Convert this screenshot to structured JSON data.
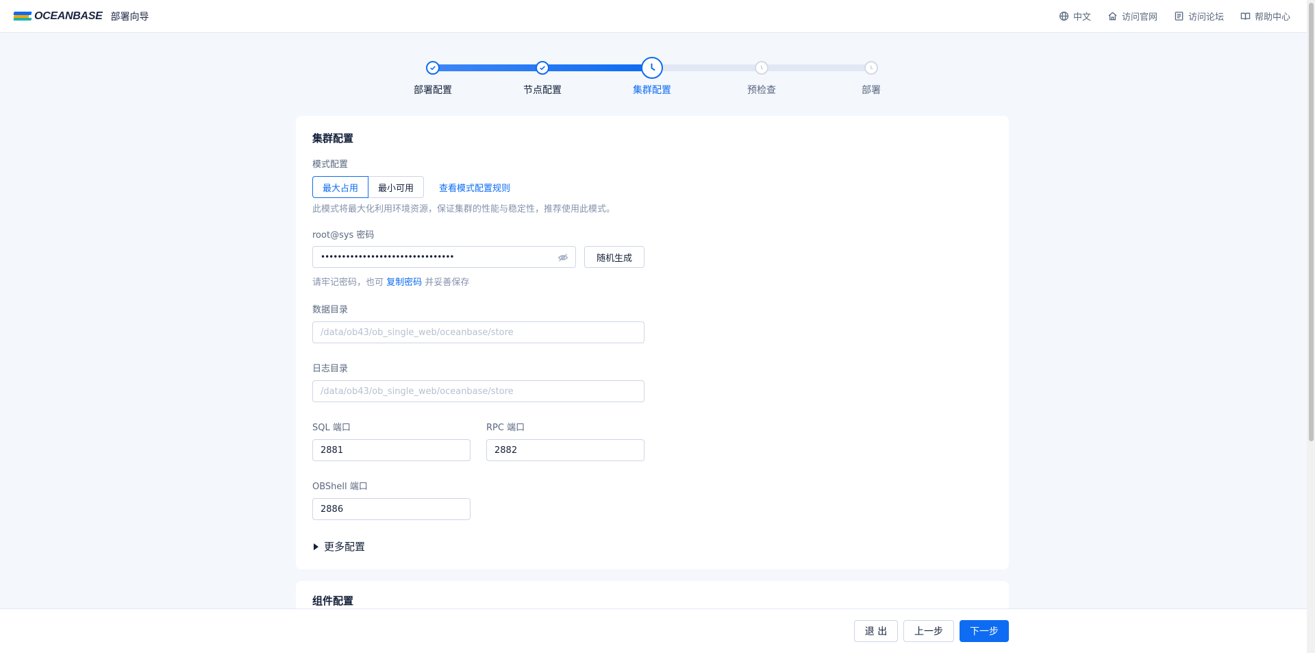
{
  "header": {
    "logo_text": "OCEANBASE",
    "app_name": "部署向导",
    "links": [
      {
        "label": "中文",
        "icon": "globe-icon"
      },
      {
        "label": "访问官网",
        "icon": "home-icon"
      },
      {
        "label": "访问论坛",
        "icon": "forum-icon"
      },
      {
        "label": "帮助中心",
        "icon": "book-icon"
      }
    ]
  },
  "steps": [
    {
      "label": "部署配置",
      "status": "done"
    },
    {
      "label": "节点配置",
      "status": "done"
    },
    {
      "label": "集群配置",
      "status": "active"
    },
    {
      "label": "预检查",
      "status": "todo"
    },
    {
      "label": "部署",
      "status": "todo"
    }
  ],
  "cluster": {
    "title": "集群配置",
    "mode_label": "模式配置",
    "mode_options": [
      "最大占用",
      "最小可用"
    ],
    "mode_selected": "最大占用",
    "mode_rule_link": "查看模式配置规则",
    "mode_hint": "此模式将最大化利用环境资源，保证集群的性能与稳定性，推荐使用此模式。",
    "password_label": "root@sys 密码",
    "password_value": "••••••••••••••••••••••••••••••••",
    "random_button": "随机生成",
    "password_hint_prefix": "请牢记密码，也可",
    "password_hint_link": "复制密码",
    "password_hint_suffix": "并妥善保存",
    "data_dir_label": "数据目录",
    "data_dir_placeholder": "/data/ob43/ob_single_web/oceanbase/store",
    "log_dir_label": "日志目录",
    "log_dir_placeholder": "/data/ob43/ob_single_web/oceanbase/store",
    "sql_port_label": "SQL 端口",
    "sql_port_value": "2881",
    "rpc_port_label": "RPC 端口",
    "rpc_port_value": "2882",
    "obshell_port_label": "OBShell 端口",
    "obshell_port_value": "2886",
    "more_config": "更多配置"
  },
  "component": {
    "title": "组件配置"
  },
  "footer": {
    "exit": "退 出",
    "prev": "上一步",
    "next": "下一步"
  },
  "colors": {
    "accent": "#0d6cf2",
    "background": "#f4f7fc"
  }
}
